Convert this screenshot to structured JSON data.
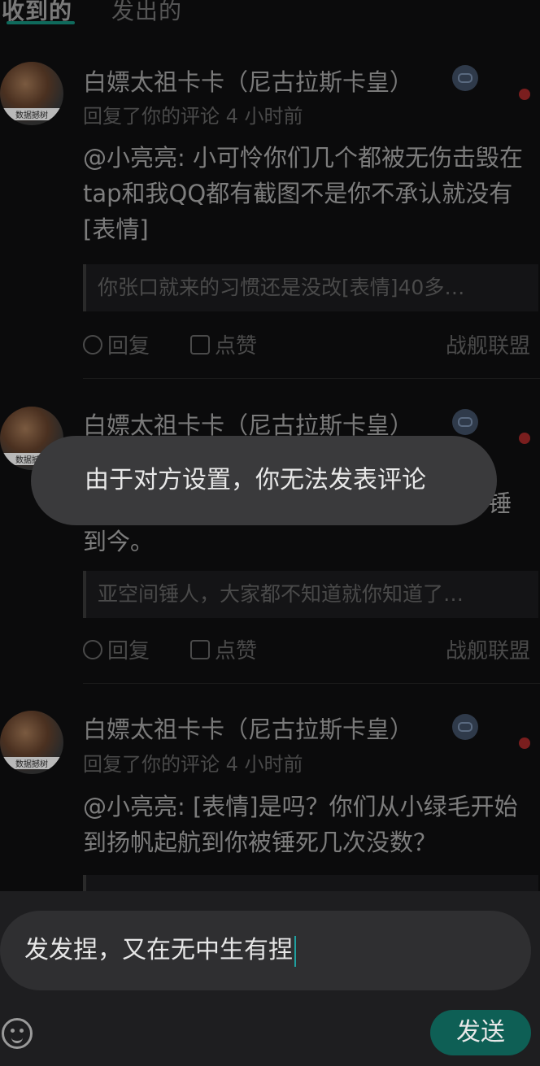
{
  "tabs": [
    {
      "label": "收到的",
      "active": true
    },
    {
      "label": "发出的",
      "active": false
    }
  ],
  "comments": [
    {
      "name": "白嫖太祖卡卡（尼古拉斯卡皇）",
      "avatar_caption": "数据撼树",
      "meta": "回复了你的评论 4 小时前",
      "content": "@小亮亮: 小可怜你们几个都被无伤击毁在tap和我QQ都有截图不是你不承认就没有[表情]",
      "quote": "你张口就来的习惯还是没改[表情]40多…",
      "reply_label": "回复",
      "like_label": "点赞",
      "source": "战舰联盟"
    },
    {
      "name": "白嫖太祖卡卡（尼古拉斯卡皇）",
      "avatar_caption": "数据撼树",
      "content_tail_right": "锤",
      "content_line": "到今。",
      "quote": "亚空间锤人，大家都不知道就你知道了…",
      "reply_label": "回复",
      "like_label": "点赞",
      "source": "战舰联盟"
    },
    {
      "name": "白嫖太祖卡卡（尼古拉斯卡皇）",
      "avatar_caption": "数据撼树",
      "meta": "回复了你的评论 4 小时前",
      "content": "@小亮亮: [表情]是吗？你们从小绿毛开始到扬帆起航到你被锤死几次没数？"
    }
  ],
  "toast": "由于对方设置，你无法发表评论",
  "composer": {
    "input_value": "发发捏，又在无中生有捏",
    "send_label": "发送"
  },
  "colors": {
    "accent": "#0e5f55",
    "unread_dot": "#7a1e1e"
  }
}
